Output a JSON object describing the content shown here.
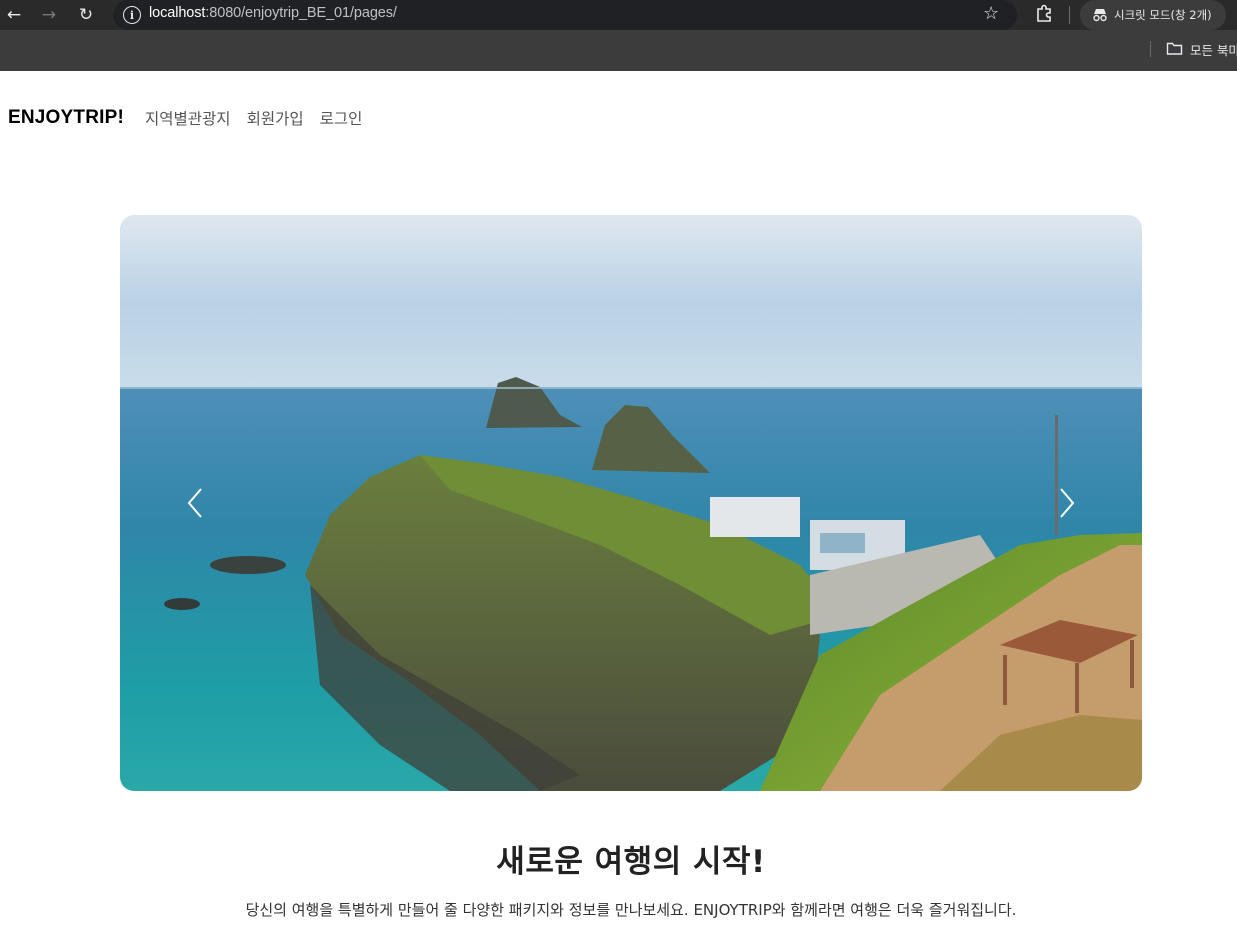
{
  "browser": {
    "url_host": "localhost",
    "url_path": ":8080/enjoytrip_BE_01/pages/",
    "incognito_label": "시크릿 모드(창 2개)",
    "bookmarks_label": "모든 북마",
    "icons": [
      "back-icon",
      "forward-icon",
      "reload-icon",
      "site-info-icon",
      "star-icon",
      "extensions-icon",
      "incognito-icon",
      "folder-icon"
    ]
  },
  "navbar": {
    "brand": "ENJOYTRIP!",
    "links": [
      {
        "label": "지역별관광지"
      },
      {
        "label": "회원가입"
      },
      {
        "label": "로그인"
      }
    ]
  },
  "carousel": {
    "prev_icon": "chevron-left-icon",
    "next_icon": "chevron-right-icon"
  },
  "hero": {
    "title": "새로운 여행의 시작!",
    "description": "당신의 여행을 특별하게 만들어 줄 다양한 패키지와 정보를 만나보세요. ENJOYTRIP와 함께라면 여행은 더욱 즐거워집니다."
  },
  "colors": {
    "chrome": "#3c3c3c",
    "omnibox": "#202124",
    "brand_text": "#000000",
    "nav_link": "#555555",
    "sea": "#2f9aa8",
    "sky": "#c9dcea"
  }
}
